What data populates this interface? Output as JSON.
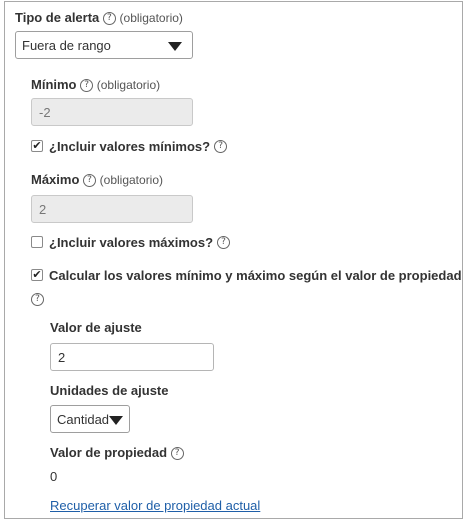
{
  "alert_type": {
    "label": "Tipo de alerta",
    "hint": "(obligatorio)",
    "selected": "Fuera de rango"
  },
  "minimum": {
    "label": "Mínimo",
    "hint": "(obligatorio)",
    "value": "-2",
    "include_label": "¿Incluir valores mínimos?",
    "include_checked": true
  },
  "maximum": {
    "label": "Máximo",
    "hint": "(obligatorio)",
    "value": "2",
    "include_label": "¿Incluir valores máximos?",
    "include_checked": false
  },
  "calc": {
    "label": "Calcular los valores mínimo y máximo según el valor de propiedad",
    "checked": true
  },
  "adjust_value": {
    "label": "Valor de ajuste",
    "value": "2"
  },
  "adjust_units": {
    "label": "Unidades de ajuste",
    "selected": "Cantidad"
  },
  "property_value": {
    "label": "Valor de propiedad",
    "value": "0"
  },
  "refresh_link": "Recuperar valor de propiedad actual",
  "help_glyph": "?",
  "check_glyph": "✔",
  "icons": {
    "help": "question-circle-icon",
    "dropdown": "triangle-down-icon",
    "check": "checkmark-icon"
  }
}
